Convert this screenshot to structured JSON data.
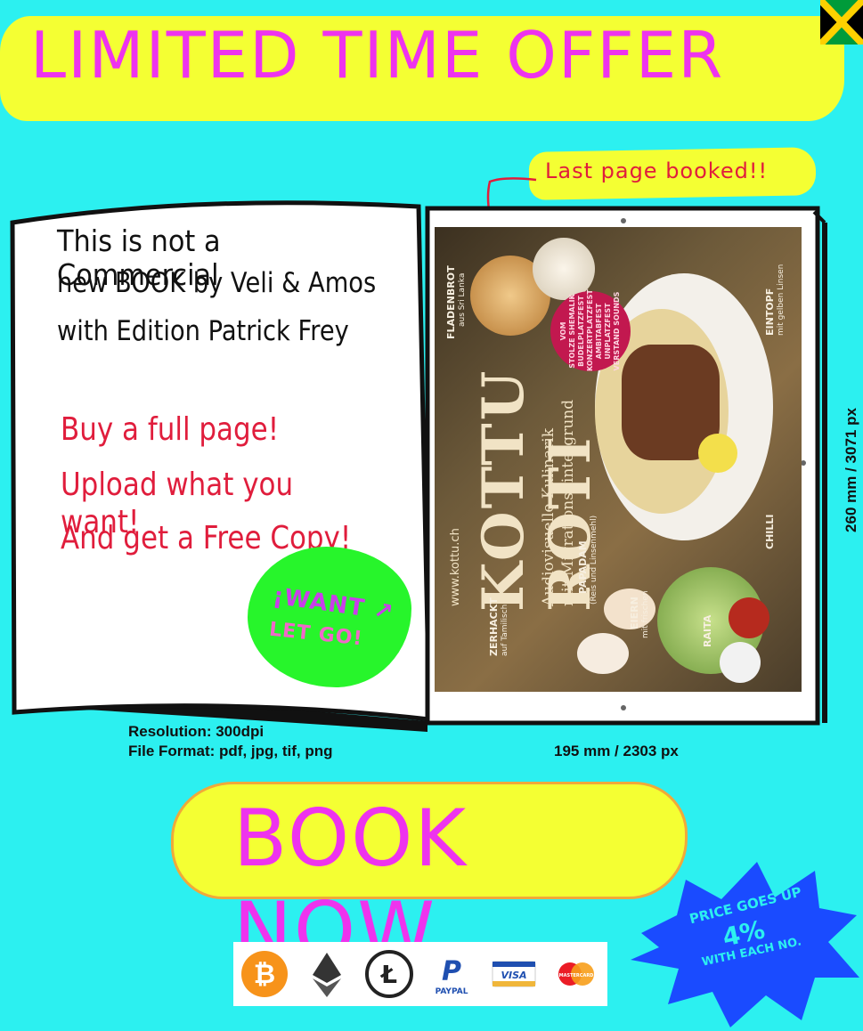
{
  "banner": {
    "title": "LIMITED TIME OFFER"
  },
  "sticker": {
    "last_page": "Last page booked!!"
  },
  "book": {
    "intro_line1": "This is not a Commercial",
    "intro_line2": "new BOOK by Veli & Amos",
    "intro_line3": "with Edition Patrick Frey",
    "offer_line1": "Buy a full page!",
    "offer_line2": "Upload what you want!",
    "offer_line3": "And get a Free Copy!",
    "badge_line1": "¡WANT ↗",
    "badge_line2": "LET GO!"
  },
  "ad": {
    "brand": "KOTTU ROTI",
    "url": "www.kottu.ch",
    "tagline1": "Audiovisuelle Kulinarik",
    "tagline2": "mit Migrationshintergrund",
    "label_fladenbrot": "FLADENBROT",
    "label_fladenbrot_sub": "aus Sri Lanka",
    "label_eintopf": "EINTOPF",
    "label_eintopf_sub": "mit gelben Linsen",
    "label_chilli": "CHILLI",
    "label_raita": "RAITA",
    "label_papadam": "PAPADAM",
    "label_papadam_sub": "(Reis und Linsenmehl)",
    "label_zerhackt": "ZERHACKT",
    "label_zerhackt_sub": "auf Tamilisch",
    "label_eiern": "EIERN",
    "label_eiern_sub": "mit frischen",
    "seal_lines": [
      "VOM",
      "STOLZE SHEMALIK",
      "BUDELPLATZFEST",
      "KONZERTPLATZFEST",
      "AMBITABFEST",
      "UNPLATZFEST",
      "VERSTAND SOUNDS"
    ]
  },
  "specs": {
    "resolution": "Resolution: 300dpi",
    "file_format": "File Format: pdf, jpg, tif, png",
    "width": "195 mm / 2303 px",
    "height": "260 mm / 3071 px"
  },
  "cta": {
    "book_now": "BOOK NOW"
  },
  "price_burst": {
    "line1": "PRICE GOES UP",
    "line2": "4%",
    "line3": "WITH EACH NO."
  },
  "payments": {
    "paypal_label": "PAYPAL",
    "visa_label": "VISA",
    "mastercard_label": "MASTERCARD"
  },
  "colors": {
    "background": "#2cf0f0",
    "highlight": "#f4ff33",
    "magenta": "#ee33ee",
    "red": "#e01d3c",
    "green": "#27f52b",
    "burst_blue": "#1a4bff"
  }
}
